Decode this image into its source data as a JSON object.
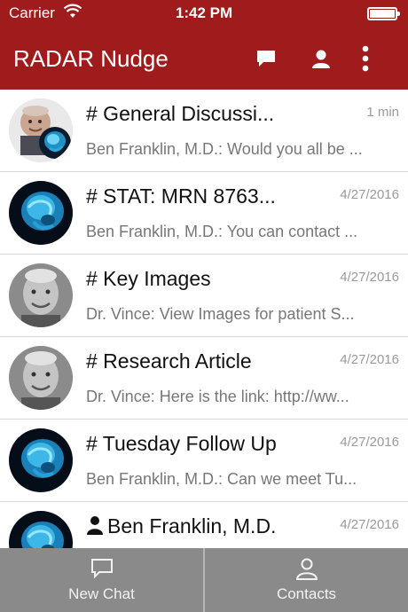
{
  "status_bar": {
    "carrier": "Carrier",
    "time": "1:42 PM",
    "wifi_icon": "wifi-icon",
    "battery_icon": "battery-icon"
  },
  "nav": {
    "title": "RADAR Nudge",
    "icons": [
      "chat-bubble-icon",
      "person-icon",
      "more-vertical-icon"
    ]
  },
  "chats": [
    {
      "name": "# General Discussi...",
      "time": "1 min",
      "preview": "Ben Franklin, M.D.: Would you all be ...",
      "avatar": "group-avatar",
      "direct": false
    },
    {
      "name": "# STAT: MRN 8763...",
      "time": "4/27/2016",
      "preview": "Ben Franklin, M.D.: You can contact ...",
      "avatar": "brain-scan-avatar",
      "direct": false
    },
    {
      "name": "# Key Images",
      "time": "4/27/2016",
      "preview": "Dr. Vince: View Images for patient S...",
      "avatar": "person-photo-avatar",
      "direct": false
    },
    {
      "name": "# Research Article",
      "time": "4/27/2016",
      "preview": "Dr. Vince: Here is the link: http://ww...",
      "avatar": "person-photo-avatar",
      "direct": false
    },
    {
      "name": "# Tuesday Follow Up",
      "time": "4/27/2016",
      "preview": "Ben Franklin, M.D.: Can we meet Tu...",
      "avatar": "brain-scan-avatar",
      "direct": false
    },
    {
      "name": "Ben Franklin, M.D.",
      "time": "4/27/2016",
      "preview": "",
      "avatar": "brain-scan-avatar",
      "direct": true
    }
  ],
  "tabs": [
    {
      "label": "New Chat",
      "icon": "chat-bubble-icon"
    },
    {
      "label": "Contacts",
      "icon": "person-icon"
    }
  ],
  "colors": {
    "brand": "#a01c1c",
    "tab_bar": "#8a8a8a",
    "muted_text": "#777777",
    "timestamp": "#9a9a9a"
  }
}
